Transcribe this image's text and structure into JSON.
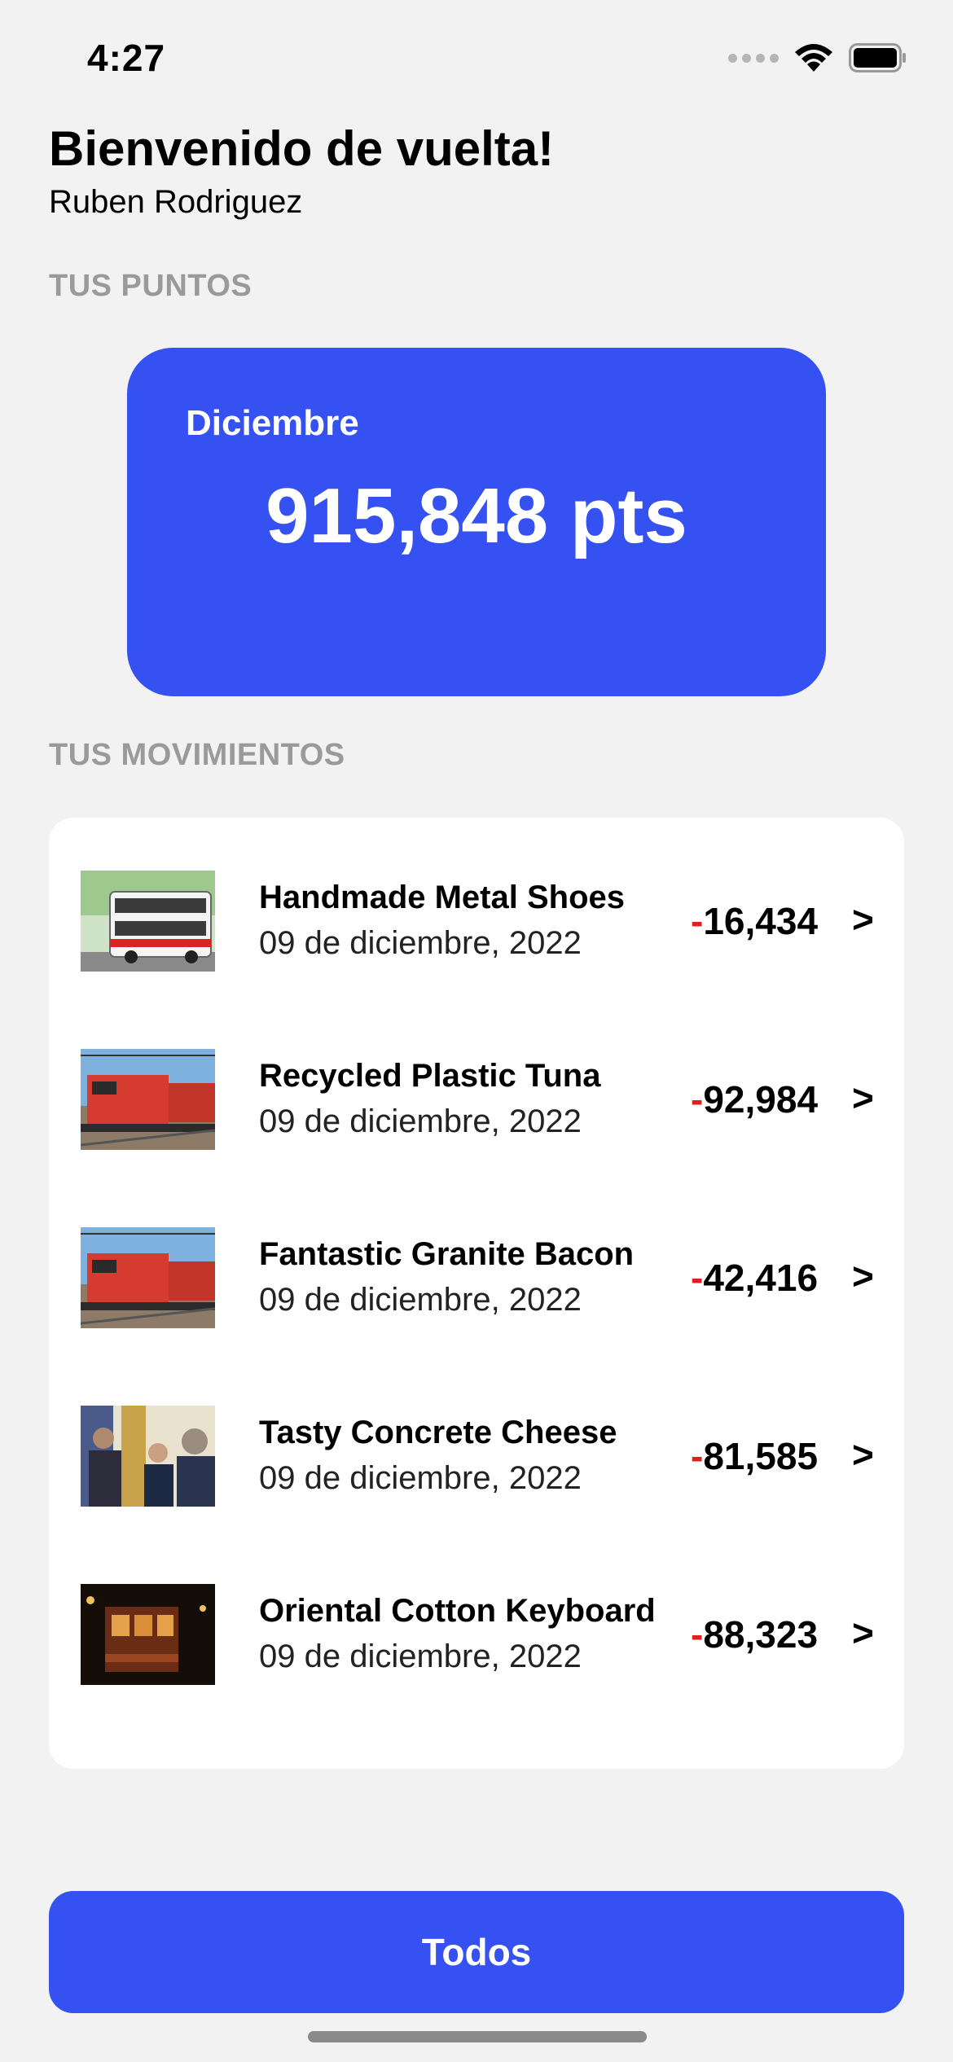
{
  "status_bar": {
    "time": "4:27",
    "icons": [
      "signal-dots-icon",
      "wifi-icon",
      "battery-icon"
    ]
  },
  "header": {
    "welcome": "Bienvenido de vuelta!",
    "user_name": "Ruben Rodriguez"
  },
  "points": {
    "section_label": "TUS PUNTOS",
    "month": "Diciembre",
    "value": "915,848 pts",
    "card_color": "#3551f2"
  },
  "movements": {
    "section_label": "TUS MOVIMIENTOS",
    "items": [
      {
        "title": "Handmade Metal Shoes",
        "date": "09 de diciembre, 2022",
        "sign": "-",
        "amount": "16,434",
        "chevron": ">",
        "thumb": "bus-photo"
      },
      {
        "title": "Recycled Plastic Tuna",
        "date": "09 de diciembre, 2022",
        "sign": "-",
        "amount": "92,984",
        "chevron": ">",
        "thumb": "train-photo"
      },
      {
        "title": "Fantastic Granite Bacon",
        "date": "09 de diciembre, 2022",
        "sign": "-",
        "amount": "42,416",
        "chevron": ">",
        "thumb": "train-photo"
      },
      {
        "title": "Tasty Concrete Cheese",
        "date": "09 de diciembre, 2022",
        "sign": "-",
        "amount": "81,585",
        "chevron": ">",
        "thumb": "people-photo"
      },
      {
        "title": "Oriental Cotton Keyboard",
        "date": "09 de diciembre, 2022",
        "sign": "-",
        "amount": "88,323",
        "chevron": ">",
        "thumb": "tram-night-photo"
      }
    ]
  },
  "footer": {
    "all_button_label": "Todos"
  },
  "colors": {
    "accent": "#3551f2",
    "negative": "#e02020",
    "background": "#f2f2f2"
  }
}
